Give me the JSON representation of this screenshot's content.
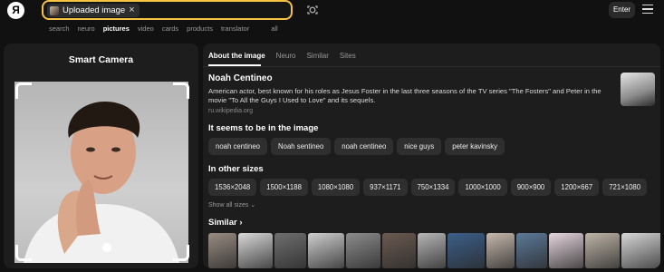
{
  "header": {
    "logo": "Я",
    "search_chip": "Uploaded image",
    "chip_close": "×",
    "enter_label": "Enter",
    "icons": [
      "camera-lens-icon",
      "hamburger-menu-icon"
    ]
  },
  "nav_tabs": [
    {
      "label": "search"
    },
    {
      "label": "neuro"
    },
    {
      "label": "pictures",
      "active": true
    },
    {
      "label": "video"
    },
    {
      "label": "cards"
    },
    {
      "label": "products"
    },
    {
      "label": "translator"
    },
    {
      "label": "all"
    }
  ],
  "left_panel": {
    "title": "Smart Camera"
  },
  "right_panel": {
    "tabs": [
      {
        "label": "About the image",
        "active": true
      },
      {
        "label": "Neuro"
      },
      {
        "label": "Similar"
      },
      {
        "label": "Sites"
      }
    ],
    "entity": {
      "name": "Noah Centineo",
      "description": "American actor, best known for his roles as Jesus Foster in the last three seasons of the TV series \"The Fosters\" and Peter in the movie \"To All the Guys I Used to Love\" and its sequels.",
      "source": "ru.wikipedia.org"
    },
    "seems_title": "It seems to be in the image",
    "seems_tags": [
      "noah centineo",
      "Noah sentineo",
      "noah centineo",
      "nice guys",
      "peter kavinsky"
    ],
    "sizes_title": "In other sizes",
    "sizes": [
      "1536×2048",
      "1500×1188",
      "1080×1080",
      "937×1171",
      "750×1334",
      "1000×1000",
      "900×900",
      "1200×667",
      "721×1080"
    ],
    "show_all": "Show all sizes ⌄",
    "similar_title": "Similar ›",
    "similar_colors": [
      "#9a8d82",
      "#d9d9d9",
      "#6f6f6f",
      "#cfcfcf",
      "#8c8c8c",
      "#6b5a50",
      "#b7b7b7",
      "#3b5f8a",
      "#c7b9ad",
      "#5c7a99",
      "#e6d6de",
      "#bfb5a8",
      "#d7d7d7"
    ]
  }
}
